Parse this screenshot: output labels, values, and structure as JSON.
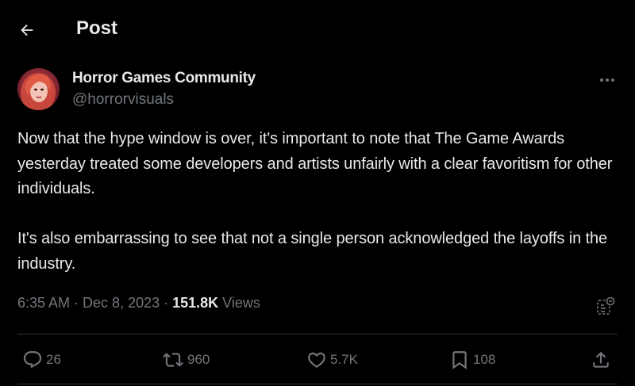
{
  "header": {
    "title": "Post"
  },
  "author": {
    "name": "Horror Games Community",
    "handle": "@horrorvisuals"
  },
  "tweet": {
    "text": "Now that the hype window is over, it's important to note that The Game Awards yesterday treated some developers and artists unfairly with a clear favoritism for other individuals.\n\nIt's also embarrassing to see that not a single person acknowledged the layoffs in the industry."
  },
  "meta": {
    "time": "6:35 AM",
    "separator": " · ",
    "date": "Dec 8, 2023",
    "views_count": "151.8K",
    "views_label": " Views"
  },
  "actions": {
    "replies": "26",
    "reposts": "960",
    "likes": "5.7K",
    "bookmarks": "108"
  },
  "icons": {
    "back": "arrow-left-icon",
    "more": "more-horizontal-icon",
    "analytics": "view-analytics-icon",
    "reply": "reply-icon",
    "repost": "repost-icon",
    "like": "heart-icon",
    "bookmark": "bookmark-icon",
    "share": "share-icon"
  },
  "colors": {
    "background": "#000000",
    "primary_text": "#e7e9ea",
    "secondary_text": "#71767b",
    "divider": "#2f3336"
  }
}
